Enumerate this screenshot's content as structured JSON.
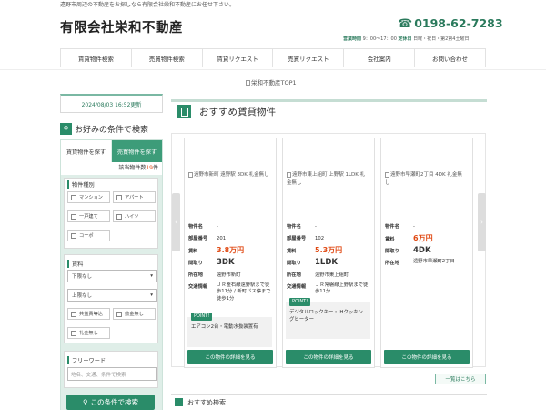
{
  "header": {
    "tagline": "遠野市周辺の不動産をお探しなら有限会社栄和不動産にお任せ下さい。",
    "logo": "有限会社栄和不動産",
    "phone": "0198-62-7283",
    "hours_label": "営業時間",
    "hours": "9：00～17：00",
    "holiday_label": "定休日",
    "holiday": "日曜・祝日・第2第4土曜日"
  },
  "nav": {
    "items": [
      "賃貸物件検索",
      "売買物件検索",
      "賃貸リクエスト",
      "売買リクエスト",
      "会社案内",
      "お問い合わせ"
    ]
  },
  "banner": {
    "alt": "栄和不動産TOP1"
  },
  "sidebar": {
    "updated": "2024/08/03 16:52更新",
    "search_title": "お好みの条件で検索",
    "tab_rent": "賃貸物件を探す",
    "tab_sale": "売買物件を探す",
    "count_label": "該当物件数",
    "count_value": "19",
    "count_unit": "件",
    "type_label": "物件種別",
    "types": [
      "マンション",
      "アパート",
      "一戸建て",
      "ハイツ",
      "コーポ"
    ],
    "rent_label": "賃料",
    "rent_min": "下限なし",
    "rent_max": "上限なし",
    "options": [
      "共益費等込",
      "敷金無し",
      "礼金無し"
    ],
    "freeword_label": "フリーワード",
    "freeword_placeholder": "地名、交通、条件で検索",
    "search_button": "この条件で検索"
  },
  "main": {
    "title": "おすすめ賃貸物件",
    "labels": {
      "name": "物件名",
      "room": "部屋番号",
      "rent": "賃料",
      "layout": "間取り",
      "address": "所在地",
      "access": "交通情報"
    },
    "point_label": "POINT!",
    "detail_button": "この物件の詳細を見る",
    "more_button": "一覧はこちら",
    "recommend_title": "おすすめ検索",
    "prev_arrow": "‹",
    "next_arrow": "›",
    "cards": [
      {
        "image_alt": "遠野市新町 遠野駅 3DK 礼金無し",
        "name": "-",
        "room": "201",
        "rent": "3.8万円",
        "layout": "3DK",
        "address": "遠野市新町",
        "access": "ＪＲ釜石線遠野駅まで徒歩11分 / 新町バス停まで徒歩1分",
        "point": "エアコン2台・電動水抜装置有"
      },
      {
        "image_alt": "遠野市東上組町 上野駅 1LDK 礼金無し",
        "name": "-",
        "room": "102",
        "rent": "5.3万円",
        "layout": "1LDK",
        "address": "遠野市東上組町",
        "access": "ＪＲ常磐線上野駅まで徒歩11分",
        "point": "デジタルロックキー・IHクッキングヒーター"
      },
      {
        "image_alt": "遠野市早瀬町2丁目 4DK 礼金無し",
        "name": "-",
        "room": "",
        "rent": "6万円",
        "layout": "4DK",
        "address": "遠野市早瀬町2丁目",
        "access": "",
        "point": ""
      }
    ]
  },
  "colors": {
    "accent": "#2a8c69",
    "price": "#e04a14",
    "panel": "#dfeee8"
  },
  "icons": [
    "phone-icon",
    "search-icon",
    "building-icon",
    "checkbox-icon",
    "chevron-down-icon",
    "image-icon"
  ]
}
